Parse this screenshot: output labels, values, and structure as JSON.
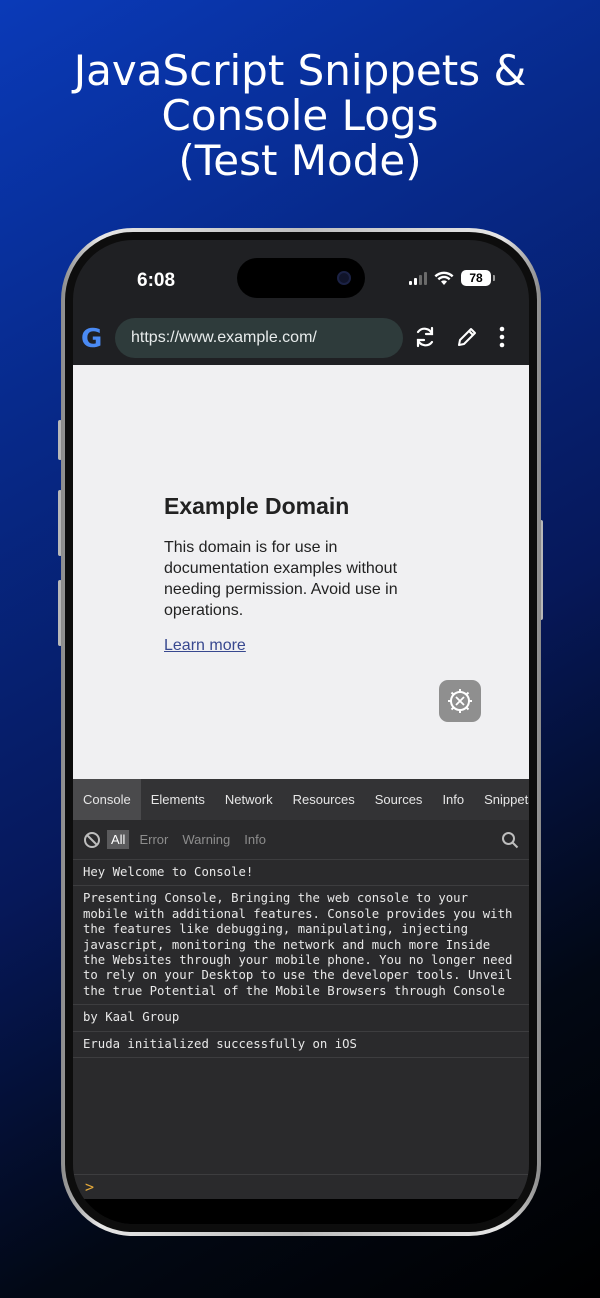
{
  "headline": {
    "line1": "JavaScript Snippets &",
    "line2": "Console Logs",
    "line3": "(Test Mode)"
  },
  "status": {
    "time": "6:08",
    "battery": "78"
  },
  "browser": {
    "url": "https://www.example.com/",
    "logo_letter": "G"
  },
  "webpage": {
    "title": "Example Domain",
    "body": "This domain is for use in documentation examples without needing permission. Avoid use in operations.",
    "link": "Learn more"
  },
  "devtools": {
    "tabs": [
      {
        "label": "Console"
      },
      {
        "label": "Elements"
      },
      {
        "label": "Network"
      },
      {
        "label": "Resources"
      },
      {
        "label": "Sources"
      },
      {
        "label": "Info"
      },
      {
        "label": "Snippets"
      }
    ],
    "filters": [
      {
        "label": "All"
      },
      {
        "label": "Error"
      },
      {
        "label": "Warning"
      },
      {
        "label": "Info"
      }
    ],
    "logs": [
      "Hey Welcome to Console!",
      "Presenting Console, Bringing the web console to your mobile with additional features. Console provides you with the features like debugging, manipulating, injecting javascript, monitoring the network and much more Inside the Websites through your mobile phone. You no longer need to rely on your Desktop to use the developer tools. Unveil the true Potential of the Mobile Browsers through Console",
      "by Kaal Group",
      "Eruda initialized successfully on iOS"
    ],
    "prompt": ">"
  },
  "colors": {
    "accent_link": "#38488f",
    "prompt": "#e5a93a",
    "google_blue": "#4a8af4"
  }
}
